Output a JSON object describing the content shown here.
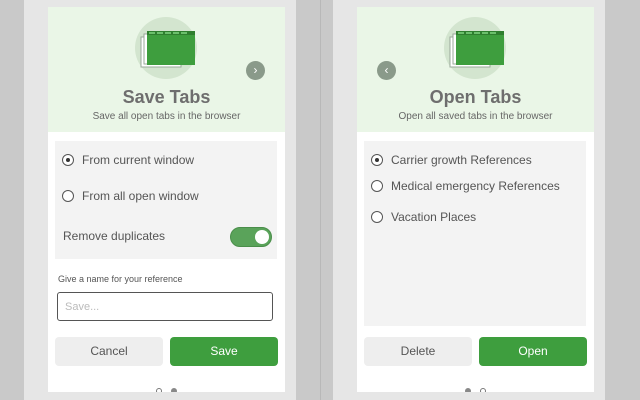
{
  "save": {
    "title": "Save Tabs",
    "subtitle": "Save all open tabs in the browser",
    "options": [
      {
        "label": "From current window",
        "checked": true
      },
      {
        "label": "From all open window",
        "checked": false
      }
    ],
    "toggle_label": "Remove duplicates",
    "toggle_on": true,
    "name_label": "Give a name for your reference",
    "name_placeholder": "Save...",
    "cancel_label": "Cancel",
    "save_label": "Save",
    "next_icon": "chevron-right-icon"
  },
  "open": {
    "title": "Open Tabs",
    "subtitle": "Open all saved tabs in the browser",
    "options": [
      {
        "label": "Carrier growth References",
        "checked": true
      },
      {
        "label": "Medical emergency References",
        "checked": false
      },
      {
        "label": "Vacation Places",
        "checked": false
      }
    ],
    "delete_label": "Delete",
    "open_label": "Open",
    "prev_icon": "chevron-left-icon"
  },
  "colors": {
    "accent": "#3e9e3e",
    "hero_bg": "#eaf6e7"
  }
}
